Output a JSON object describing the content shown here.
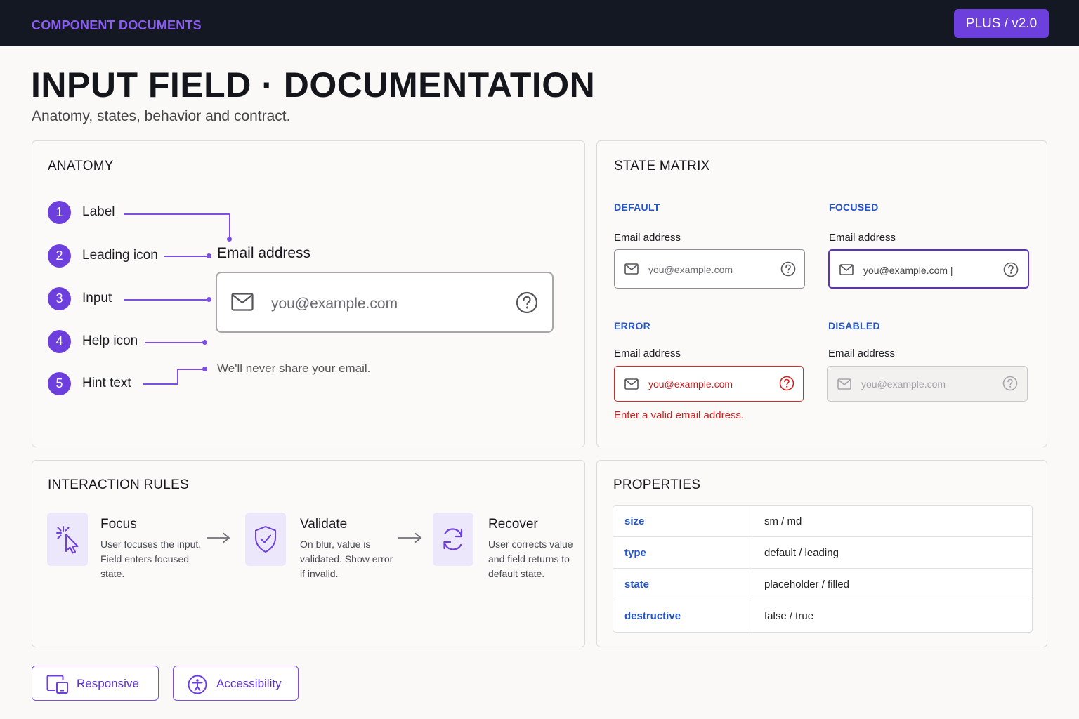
{
  "header": {
    "brand": "COMPONENT DOCUMENTS",
    "version_badge": "PLUS / v2.0"
  },
  "page": {
    "title": "INPUT FIELD · DOCUMENTATION",
    "subtitle": "Anatomy, states, behavior and contract."
  },
  "anatomy": {
    "title": "ANATOMY",
    "items": [
      {
        "number": "1",
        "label": "Label"
      },
      {
        "number": "2",
        "label": "Leading icon"
      },
      {
        "number": "3",
        "label": "Input"
      },
      {
        "number": "4",
        "label": "Help icon"
      },
      {
        "number": "5",
        "label": "Hint text"
      }
    ],
    "demo": {
      "label": "Email address",
      "placeholder": "you@example.com",
      "hint": "We'll never share your email.",
      "icons": [
        "mail-icon",
        "help-icon"
      ]
    }
  },
  "state_matrix": {
    "title": "STATE MATRIX",
    "states": [
      {
        "name": "DEFAULT",
        "label": "Email address",
        "value": "you@example.com"
      },
      {
        "name": "FOCUSED",
        "label": "Email address",
        "value": "you@example.com |"
      },
      {
        "name": "ERROR",
        "label": "Email address",
        "value": "you@example.com",
        "message": "Enter a valid email address."
      },
      {
        "name": "DISABLED",
        "label": "Email address",
        "value": "you@example.com"
      }
    ]
  },
  "interaction": {
    "title": "INTERACTION RULES",
    "steps": [
      {
        "title": "Focus",
        "line1": "User focuses the input.",
        "line2": "Field enters focused",
        "line3": "state.",
        "icon": "cursor-click-icon"
      },
      {
        "title": "Validate",
        "line1": "On blur, value is",
        "line2": "validated. Show error",
        "line3": "if invalid.",
        "icon": "shield-check-icon"
      },
      {
        "title": "Recover",
        "line1": "User corrects value",
        "line2": "and field returns to",
        "line3": "default state.",
        "icon": "refresh-icon"
      }
    ]
  },
  "properties": {
    "title": "PROPERTIES",
    "rows": [
      {
        "key": "size",
        "value": "sm / md"
      },
      {
        "key": "type",
        "value": "default / leading"
      },
      {
        "key": "state",
        "value": "placeholder / filled"
      },
      {
        "key": "destructive",
        "value": "false / true"
      }
    ]
  },
  "footer": {
    "responsive": "Responsive",
    "accessibility": "Accessibility"
  },
  "colors": {
    "accent": "#6d3fdc",
    "state_heading": "#2354c9",
    "error": "#cf1f1f",
    "topbar": "#141823"
  }
}
